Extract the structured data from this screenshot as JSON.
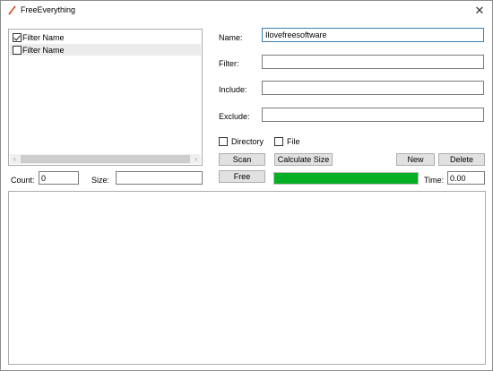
{
  "window": {
    "title": "FreeEverything",
    "close_glyph": "✕",
    "icon": "feather-icon"
  },
  "filters": {
    "items": [
      {
        "label": "Filter Name",
        "checked": true
      },
      {
        "label": "Filter Name",
        "checked": false
      }
    ],
    "scroll_left": "‹",
    "scroll_right": "›"
  },
  "stats": {
    "count_label": "Count:",
    "count_value": "0",
    "size_label": "Size:",
    "size_value": ""
  },
  "form": {
    "name_label": "Name:",
    "name_value": "Ilovefreesoftware",
    "filter_label": "Filter:",
    "filter_value": "",
    "include_label": "Include:",
    "include_value": "",
    "exclude_label": "Exclude:",
    "exclude_value": "",
    "directory_label": "Directory",
    "directory_checked": false,
    "file_label": "File",
    "file_checked": false
  },
  "buttons": {
    "scan": "Scan",
    "calculate_size": "Calculate Size",
    "new": "New",
    "delete": "Delete",
    "free": "Free"
  },
  "progress": {
    "fraction": 1.0,
    "color": "#06b025"
  },
  "time": {
    "label": "Time:",
    "value": "0.00"
  },
  "output": {
    "text": ""
  }
}
